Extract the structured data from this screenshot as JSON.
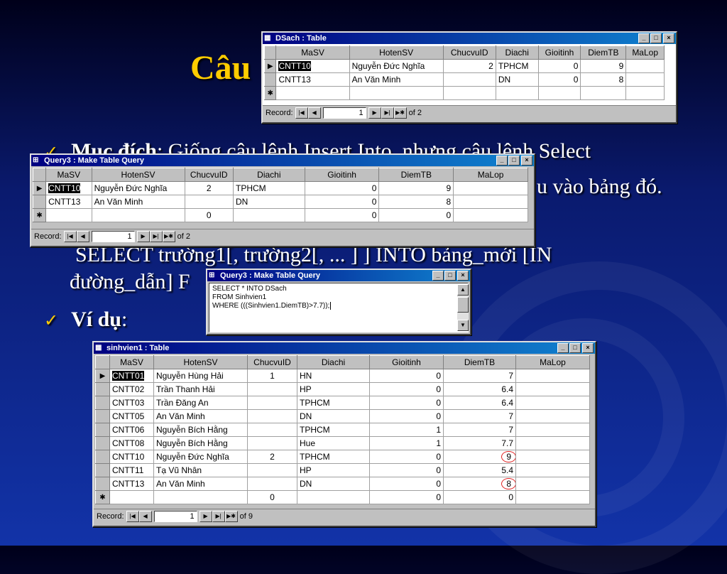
{
  "slide": {
    "title": "Câu",
    "line1_bold": "Mục đích",
    "line1_rest": ": Giống câu lệnh Insert Into, nhưng câu lệnh Select",
    "line2": "u vào bảng đó.",
    "syntax1": "SELECT  trường1[, trường2[, ... ] ] INTO bảng_mới [IN",
    "syntax2": "đường_dẫn]  F",
    "example_label": "Ví dụ",
    "example_colon": ":"
  },
  "dsach": {
    "title": "DSach : Table",
    "columns": [
      "MaSV",
      "HotenSV",
      "ChucvuID",
      "Diachi",
      "Gioitinh",
      "DiemTB",
      "MaLop"
    ],
    "rows": [
      [
        "CNTT10",
        "Nguyễn Đức Nghĩa",
        "2",
        "TPHCM",
        "0",
        "9",
        ""
      ],
      [
        "CNTT13",
        "An Văn Minh",
        "",
        "DN",
        "0",
        "8",
        ""
      ]
    ],
    "record_label": "Record:",
    "record_value": "1",
    "record_of": "of 2"
  },
  "query_grid": {
    "title": "Query3 : Make Table Query",
    "columns": [
      "MaSV",
      "HotenSV",
      "ChucvuID",
      "Diachi",
      "Gioitinh",
      "DiemTB",
      "MaLop"
    ],
    "rows": [
      [
        "CNTT10",
        "Nguyễn Đức Nghĩa",
        "2",
        "TPHCM",
        "0",
        "9",
        ""
      ],
      [
        "CNTT13",
        "An Văn Minh",
        "",
        "DN",
        "0",
        "8",
        ""
      ]
    ],
    "new_row": [
      "",
      "",
      "0",
      "",
      "0",
      "0",
      ""
    ],
    "record_label": "Record:",
    "record_value": "1",
    "record_of": "of 2"
  },
  "query_sql": {
    "title": "Query3 : Make Table Query",
    "lines": [
      "SELECT * INTO DSach",
      "FROM Sinhvien1",
      "WHERE (((Sinhvien1.DiemTB)>7.7));"
    ]
  },
  "sinhvien": {
    "title": "sinhvien1 : Table",
    "columns": [
      "MaSV",
      "HotenSV",
      "ChucvuID",
      "Diachi",
      "Gioitinh",
      "DiemTB",
      "MaLop"
    ],
    "rows": [
      [
        "CNTT01",
        "Nguyễn Hùng Hải",
        "1",
        "HN",
        "0",
        "7",
        ""
      ],
      [
        "CNTT02",
        "Trần Thanh Hải",
        "",
        "HP",
        "0",
        "6.4",
        ""
      ],
      [
        "CNTT03",
        "Trần Đăng An",
        "",
        "TPHCM",
        "0",
        "6.4",
        ""
      ],
      [
        "CNTT05",
        "An Văn Minh",
        "",
        "DN",
        "0",
        "7",
        ""
      ],
      [
        "CNTT06",
        "Nguyễn Bích Hằng",
        "",
        "TPHCM",
        "1",
        "7",
        ""
      ],
      [
        "CNTT08",
        "Nguyễn Bích Hằng",
        "",
        "Hue",
        "1",
        "7.7",
        ""
      ],
      [
        "CNTT10",
        "Nguyễn Đức Nghĩa",
        "2",
        "TPHCM",
        "0",
        "9",
        ""
      ],
      [
        "CNTT11",
        "Tạ Vũ Nhân",
        "",
        "HP",
        "0",
        "5.4",
        ""
      ],
      [
        "CNTT13",
        "An Văn Minh",
        "",
        "DN",
        "0",
        "8",
        ""
      ]
    ],
    "new_row": [
      "",
      "",
      "0",
      "",
      "0",
      "0",
      ""
    ],
    "record_label": "Record:",
    "record_value": "1",
    "record_of": "of 9"
  }
}
